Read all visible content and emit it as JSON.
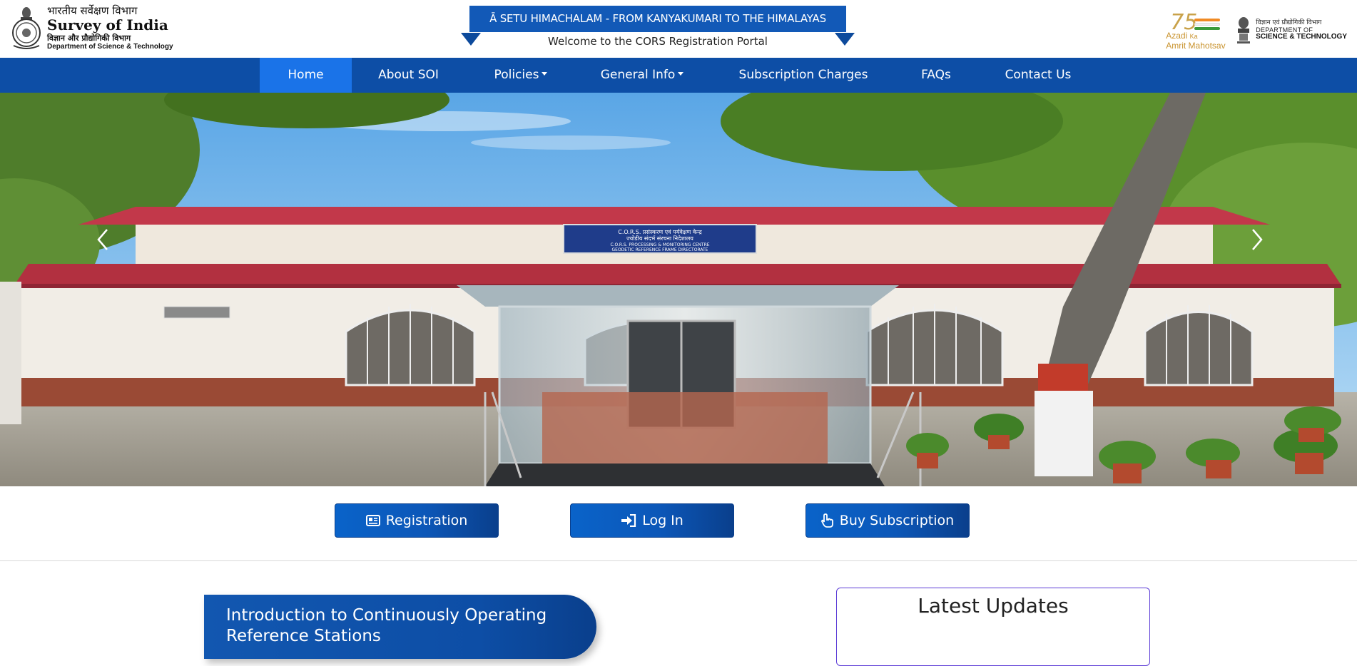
{
  "header": {
    "org_hindi": "भारतीय सर्वेक्षण विभाग",
    "org_name": "Survey of India",
    "dept_hindi": "विज्ञान और प्रौद्योगिकी विभाग",
    "dept_name": "Department of Science & Technology",
    "banner_text": "Ā SETU HIMACHALAM - FROM KANYAKUMARI TO THE HIMALAYAS",
    "welcome_text": "Welcome to the CORS Registration Portal",
    "azadi_line1": "Azadi",
    "azadi_line2": "Ka",
    "azadi_line3": "Amrit",
    "azadi_line4": "Mahotsav",
    "dst_hindi": "विज्ञान एवं प्रौद्योगिकी विभाग",
    "dst_of": "DEPARTMENT OF",
    "dst_name": "SCIENCE & TECHNOLOGY"
  },
  "nav": {
    "items": [
      {
        "label": "Home"
      },
      {
        "label": "About SOI"
      },
      {
        "label": "Policies"
      },
      {
        "label": "General Info"
      },
      {
        "label": "Subscription Charges"
      },
      {
        "label": "FAQs"
      },
      {
        "label": "Contact Us"
      }
    ]
  },
  "hero": {
    "board_line1": "C.O.R.S. प्रसंस्करण एवं पर्यवेक्षण केन्द्र",
    "board_line2": "ज्योडीय संदर्भ संरचना निदेशालय",
    "board_line3": "C.O.R.S. PROCESSING & MONITORING CENTRE",
    "board_line4": "GEODETIC REFERENCE FRAME DIRECTORATE"
  },
  "actions": {
    "registration": "Registration",
    "login": "Log In",
    "buy": "Buy Subscription"
  },
  "intro": {
    "title_line1": "Introduction to Continuously Operating",
    "title_line2": "Reference Stations"
  },
  "updates": {
    "title": "Latest Updates"
  },
  "colors": {
    "nav_bg": "#0d4ea6",
    "nav_active": "#1a73e8",
    "banner": "#1259b7",
    "updates_border": "#5b3bd6"
  }
}
